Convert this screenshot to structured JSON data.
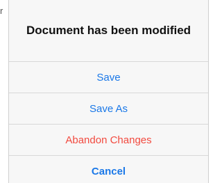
{
  "edge_char": "r",
  "dialog": {
    "title": "Document has been modified",
    "actions": {
      "save": "Save",
      "save_as": "Save As",
      "abandon": "Abandon Changes",
      "cancel": "Cancel"
    }
  },
  "colors": {
    "action_blue": "#1a78e8",
    "destructive_red": "#f24a3f",
    "sheet_bg": "#f7f7f7"
  }
}
